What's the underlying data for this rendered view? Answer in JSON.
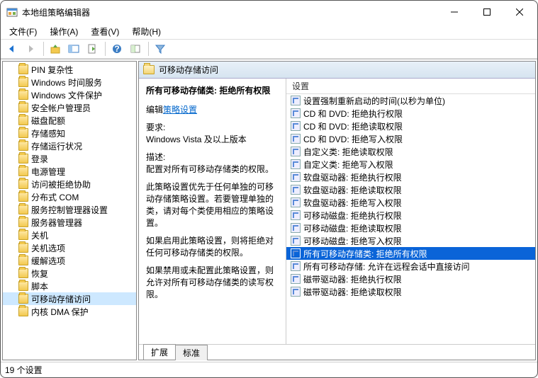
{
  "window": {
    "title": "本地组策略编辑器"
  },
  "menubar": {
    "file": "文件(F)",
    "action": "操作(A)",
    "view": "查看(V)",
    "help": "帮助(H)"
  },
  "tree": {
    "items": [
      {
        "label": "PIN 复杂性"
      },
      {
        "label": "Windows 时间服务"
      },
      {
        "label": "Windows 文件保护"
      },
      {
        "label": "安全帐户管理员"
      },
      {
        "label": "磁盘配额"
      },
      {
        "label": "存储感知"
      },
      {
        "label": "存储运行状况"
      },
      {
        "label": "登录"
      },
      {
        "label": "电源管理"
      },
      {
        "label": "访问被拒绝协助"
      },
      {
        "label": "分布式 COM"
      },
      {
        "label": "服务控制管理器设置"
      },
      {
        "label": "服务器管理器"
      },
      {
        "label": "关机"
      },
      {
        "label": "关机选项"
      },
      {
        "label": "缓解选项"
      },
      {
        "label": "恢复"
      },
      {
        "label": "脚本"
      },
      {
        "label": "可移动存储访问",
        "selected": true
      },
      {
        "label": "内核 DMA 保护"
      }
    ]
  },
  "header": {
    "title": "可移动存储访问"
  },
  "description": {
    "title": "所有可移动存储类: 拒绝所有权限",
    "edit_prefix": "编辑",
    "edit_link": "策略设置",
    "req_label": "要求:",
    "req_value": "Windows Vista 及以上版本",
    "desc_label": "描述:",
    "desc_1": "配置对所有可移动存储类的权限。",
    "desc_2": "此策略设置优先于任何单独的可移动存储策略设置。若要管理单独的类，请对每个类使用相应的策略设置。",
    "desc_3": "如果启用此策略设置，则将拒绝对任何可移动存储类的权限。",
    "desc_4": "如果禁用或未配置此策略设置，则允许对所有可移动存储类的读写权限。"
  },
  "list": {
    "column": "设置",
    "items": [
      {
        "label": "设置强制重新启动的时间(以秒为单位)"
      },
      {
        "label": "CD 和 DVD: 拒绝执行权限"
      },
      {
        "label": "CD 和 DVD: 拒绝读取权限"
      },
      {
        "label": "CD 和 DVD: 拒绝写入权限"
      },
      {
        "label": "自定义类: 拒绝读取权限"
      },
      {
        "label": "自定义类: 拒绝写入权限"
      },
      {
        "label": "软盘驱动器: 拒绝执行权限"
      },
      {
        "label": "软盘驱动器: 拒绝读取权限"
      },
      {
        "label": "软盘驱动器: 拒绝写入权限"
      },
      {
        "label": "可移动磁盘: 拒绝执行权限"
      },
      {
        "label": "可移动磁盘: 拒绝读取权限"
      },
      {
        "label": "可移动磁盘: 拒绝写入权限"
      },
      {
        "label": "所有可移动存储类: 拒绝所有权限",
        "selected": true
      },
      {
        "label": "所有可移动存储: 允许在远程会话中直接访问"
      },
      {
        "label": "磁带驱动器: 拒绝执行权限"
      },
      {
        "label": "磁带驱动器: 拒绝读取权限"
      }
    ]
  },
  "tabs": {
    "extended": "扩展",
    "standard": "标准"
  },
  "status": {
    "text": "19 个设置"
  }
}
